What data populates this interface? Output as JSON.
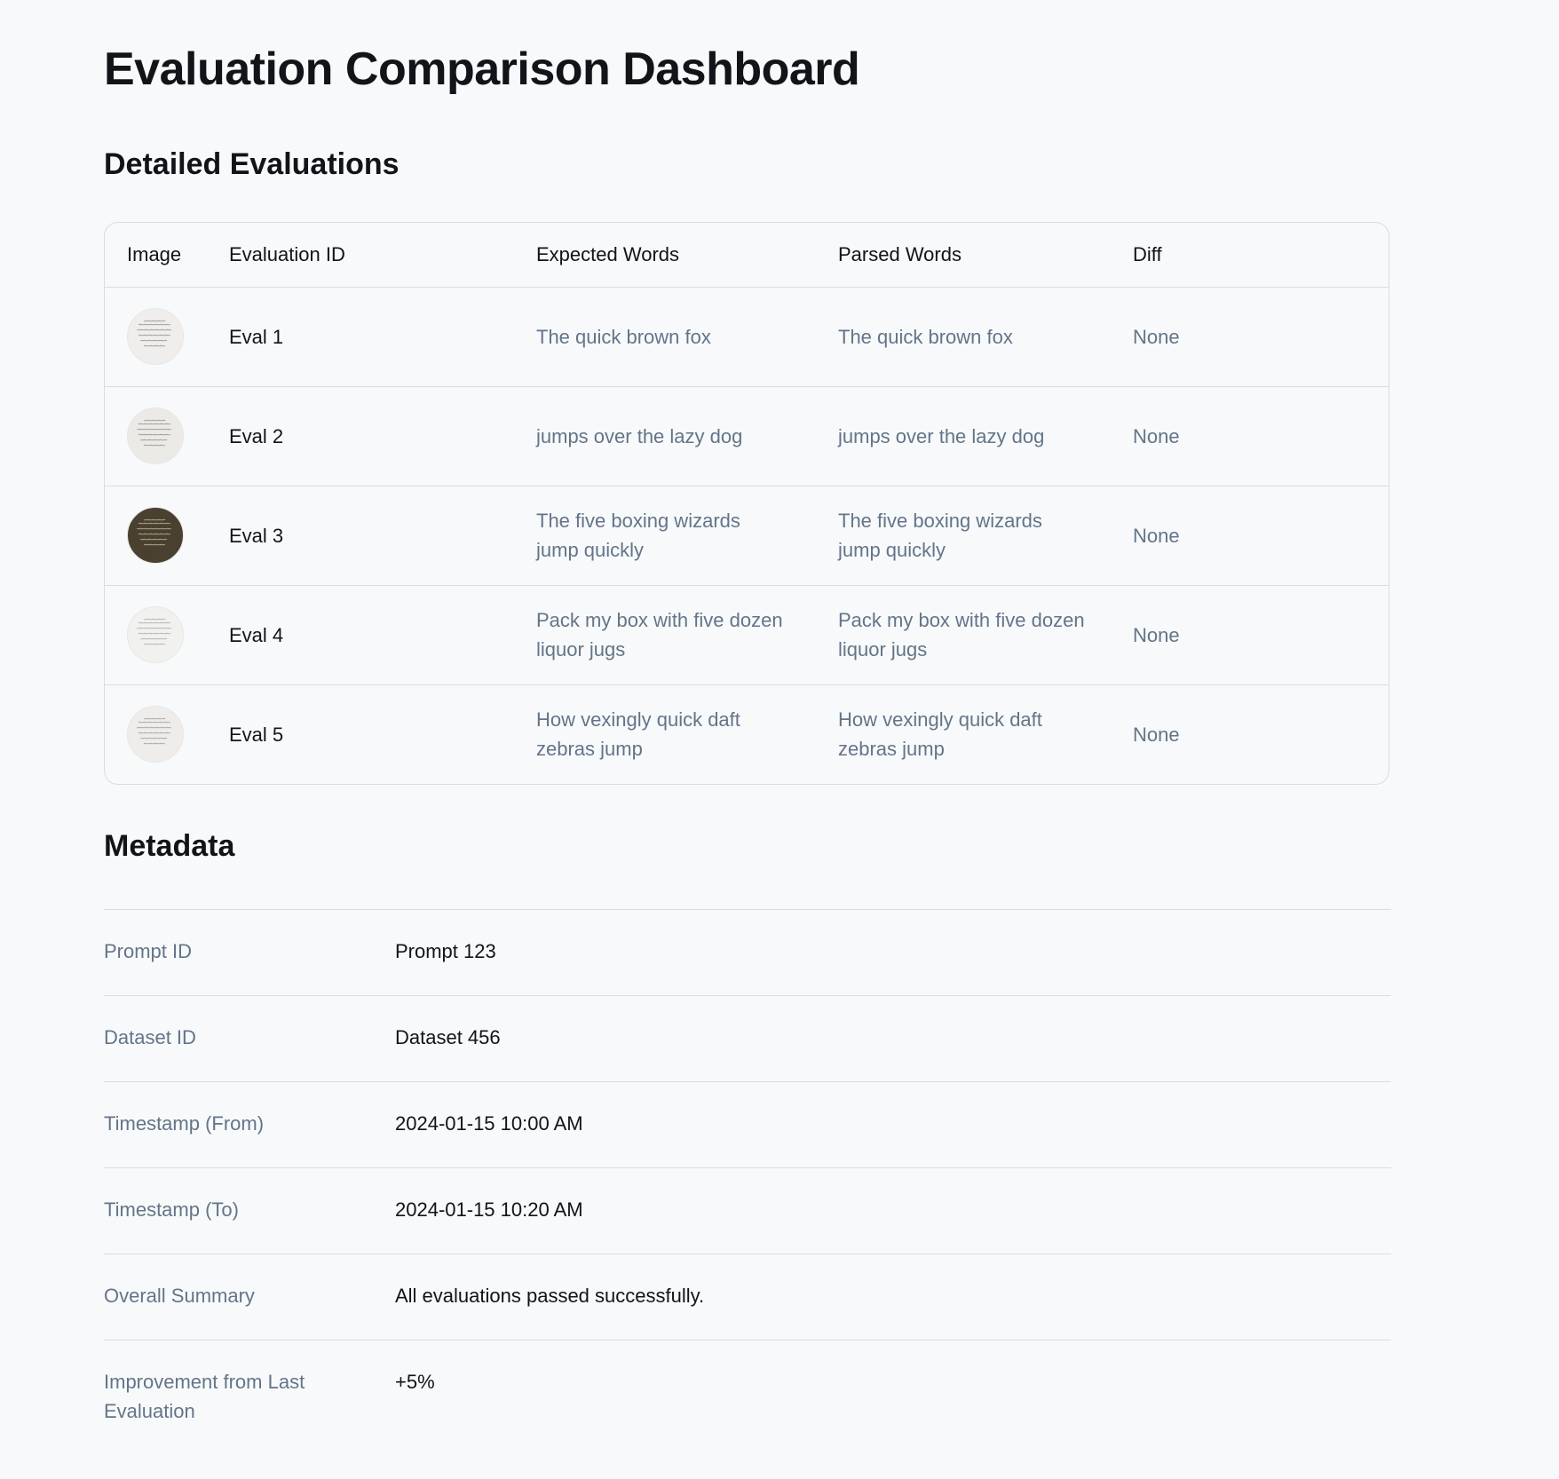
{
  "header": {
    "title": "Evaluation Comparison Dashboard"
  },
  "evaluations": {
    "title": "Detailed Evaluations",
    "columns": [
      "Image",
      "Evaluation ID",
      "Expected Words",
      "Parsed Words",
      "Diff"
    ],
    "rows": [
      {
        "id": "Eval 1",
        "expected": "The quick brown fox",
        "parsed": "The quick brown fox",
        "diff": "None",
        "thumb_bg": "#efeeec",
        "ink": "#8a8a86"
      },
      {
        "id": "Eval 2",
        "expected": "jumps over the lazy dog",
        "parsed": "jumps over the lazy dog",
        "diff": "None",
        "thumb_bg": "#ebeae7",
        "ink": "#8c8a84"
      },
      {
        "id": "Eval 3",
        "expected": "The five boxing wizards jump quickly",
        "parsed": "The five boxing wizards jump quickly",
        "diff": "None",
        "thumb_bg": "#4a4030",
        "ink": "#c9bfa0"
      },
      {
        "id": "Eval 4",
        "expected": "Pack my box with five dozen liquor jugs",
        "parsed": "Pack my box with five dozen liquor jugs",
        "diff": "None",
        "thumb_bg": "#f1f1ef",
        "ink": "#a6a6a2"
      },
      {
        "id": "Eval 5",
        "expected": "How vexingly quick daft zebras jump",
        "parsed": "How vexingly quick daft zebras jump",
        "diff": "None",
        "thumb_bg": "#eeedeb",
        "ink": "#9a9893"
      }
    ]
  },
  "metadata": {
    "title": "Metadata",
    "items": [
      {
        "label": "Prompt ID",
        "value": "Prompt 123"
      },
      {
        "label": "Dataset ID",
        "value": "Dataset 456"
      },
      {
        "label": "Timestamp (From)",
        "value": "2024-01-15 10:00 AM"
      },
      {
        "label": "Timestamp (To)",
        "value": "2024-01-15 10:20 AM"
      },
      {
        "label": "Overall Summary",
        "value": "All evaluations passed successfully."
      },
      {
        "label": "Improvement from Last Evaluation",
        "value": "+5%"
      }
    ]
  }
}
